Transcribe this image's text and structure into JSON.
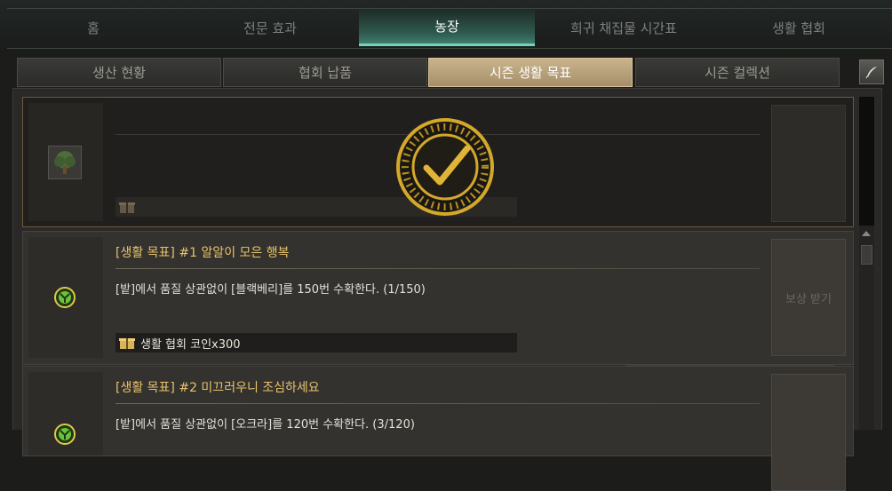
{
  "top_nav": {
    "tabs": [
      {
        "label": "홈",
        "active": false
      },
      {
        "label": "전문 효과",
        "active": false
      },
      {
        "label": "농장",
        "active": true
      },
      {
        "label": "희귀 채집물 시간표",
        "active": false
      },
      {
        "label": "생활 협회",
        "active": false
      }
    ]
  },
  "sub_nav": {
    "tabs": [
      {
        "label": "생산 현황",
        "active": false
      },
      {
        "label": "협회 납품",
        "active": false
      },
      {
        "label": "시즌 생활 목표",
        "active": true
      },
      {
        "label": "시즌 컬렉션",
        "active": false
      }
    ]
  },
  "goals": [
    {
      "status": "completed",
      "icon": "tree-icon",
      "title": "",
      "description": "",
      "reward": "",
      "claim_label": ""
    },
    {
      "status": "in-progress",
      "icon": "seed-icon",
      "title": "[생활 목표] #1 알알이 모은 행복",
      "description": "[밭]에서 품질 상관없이 [블랙베리]를 150번 수확한다. (1/150)",
      "progress": {
        "current": 1,
        "total": 150
      },
      "reward": "생활 협회 코인x300",
      "claim_label": "보상 받기"
    },
    {
      "status": "in-progress",
      "icon": "seed-icon",
      "title": "[생활 목표] #2 미끄러우니 조심하세요",
      "description": "[밭]에서 품질 상관없이 [오크라]를 120번 수확한다. (3/120)",
      "progress": {
        "current": 3,
        "total": 120
      },
      "reward": "",
      "claim_label": ""
    }
  ],
  "colors": {
    "accent_teal": "#6fd4b8",
    "active_subtab": "#b8a07a",
    "title_gold": "#e7c26b",
    "seal_gold": "#d4a82a"
  }
}
